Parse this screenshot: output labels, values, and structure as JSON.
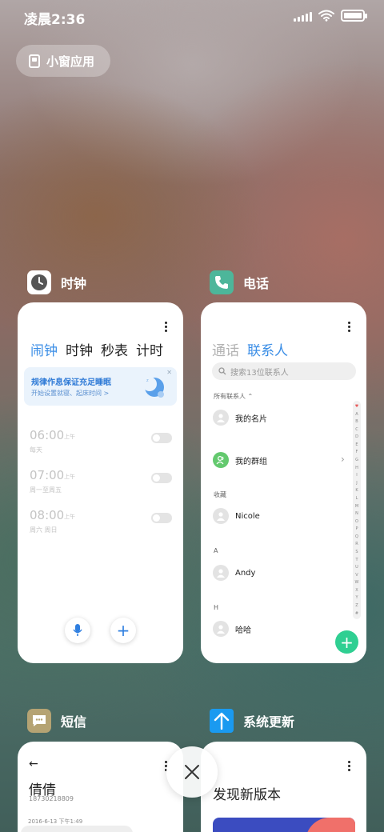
{
  "status": {
    "time": "凌晨2:36",
    "battery_level": 1.0
  },
  "mini_window_button": {
    "label": "小窗应用"
  },
  "colors": {
    "accent_blue": "#3b8ee6",
    "phone_green": "#2fcf92",
    "update_blue": "#1a9af0"
  },
  "recents": [
    {
      "app_name": "时钟",
      "icon": "clock-icon",
      "tabs": [
        "闹钟",
        "时钟",
        "秒表",
        "计时"
      ],
      "active_tab": "闹钟",
      "banner": {
        "title": "规律作息保证充足睡眠",
        "subtitle": "开始设置就寝、起床时间 >"
      },
      "alarms": [
        {
          "time": "06:00",
          "ampm": "上午",
          "days": "每天",
          "enabled": false
        },
        {
          "time": "07:00",
          "ampm": "上午",
          "days": "周一至周五",
          "enabled": false
        },
        {
          "time": "08:00",
          "ampm": "上午",
          "days": "周六 周日",
          "enabled": false
        }
      ]
    },
    {
      "app_name": "电话",
      "icon": "phone-icon",
      "tabs": [
        "通话",
        "联系人"
      ],
      "active_tab": "联系人",
      "search_placeholder": "搜索13位联系人",
      "all_contacts_label": "所有联系人",
      "my_card": "我的名片",
      "my_groups": "我的群组",
      "favorites_label": "收藏",
      "contacts": [
        {
          "section": "",
          "name": "Nicole"
        },
        {
          "section": "A",
          "name": "Andy"
        },
        {
          "section": "H",
          "name": "哈哈"
        }
      ],
      "index_letters": [
        "♥",
        "A",
        "B",
        "C",
        "D",
        "E",
        "F",
        "G",
        "H",
        "I",
        "J",
        "K",
        "L",
        "M",
        "N",
        "O",
        "P",
        "Q",
        "R",
        "S",
        "T",
        "U",
        "V",
        "W",
        "X",
        "Y",
        "Z",
        "#"
      ]
    },
    {
      "app_name": "短信",
      "icon": "message-icon",
      "back": "←",
      "contact_name": "倩倩",
      "contact_number": "18730218809",
      "message_date": "2016-6-13 下午1:49"
    },
    {
      "app_name": "系统更新",
      "icon": "update-arrow-icon",
      "title": "发现新版本"
    }
  ],
  "close_all_icon": "close-icon"
}
